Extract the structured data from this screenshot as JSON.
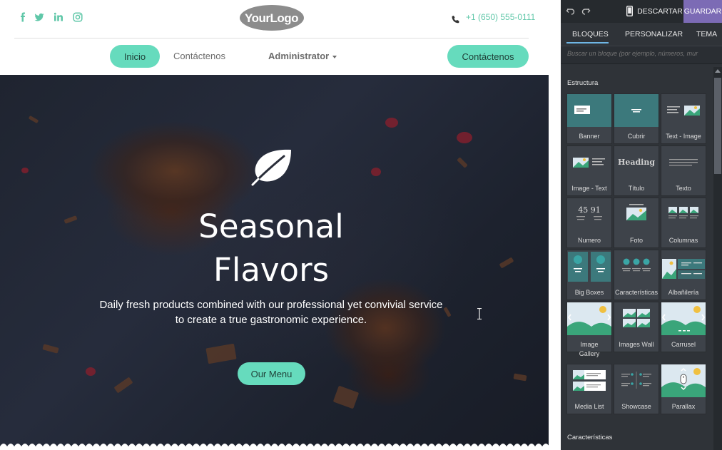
{
  "site": {
    "logo_text": "YourLogo",
    "phone": "+1 (650) 555-0111",
    "social": [
      "facebook-icon",
      "twitter-icon",
      "linkedin-icon",
      "instagram-icon"
    ],
    "nav": {
      "home": "Inicio",
      "contact": "Contáctenos",
      "admin": "Administrator",
      "cta": "Contáctenos"
    },
    "hero": {
      "title": "Seasonal\nFlavors",
      "subtitle": "Daily fresh products combined with our professional yet convivial service\nto create a true gastronomic experience.",
      "button": "Our Menu"
    },
    "accent": "#66dbbd",
    "icon_accent": "#5fc7a8"
  },
  "editor": {
    "discard": "DESCARTAR",
    "save": "GUARDAR",
    "save_color": "#7c6bb5",
    "tabs": [
      "BLOQUES",
      "PERSONALIZAR",
      "TEMA"
    ],
    "active_tab": "BLOQUES",
    "search_placeholder": "Buscar un bloque (por ejemplo, números, mur",
    "sections": {
      "structure": "Estructura",
      "features": "Características"
    },
    "blocks": [
      {
        "label": "Banner",
        "icon": "banner-icon"
      },
      {
        "label": "Cubrir",
        "icon": "cover-icon"
      },
      {
        "label": "Text - Image",
        "icon": "text-image-icon"
      },
      {
        "label": "Image - Text",
        "icon": "image-text-icon"
      },
      {
        "label": "Título",
        "icon": "heading-icon",
        "thumb_text": "Heading"
      },
      {
        "label": "Texto",
        "icon": "text-icon"
      },
      {
        "label": "Numero",
        "icon": "numbers-icon",
        "thumb_text": "45 91"
      },
      {
        "label": "Foto",
        "icon": "picture-icon"
      },
      {
        "label": "Columnas",
        "icon": "columns-icon"
      },
      {
        "label": "Big Boxes",
        "icon": "big-boxes-icon"
      },
      {
        "label": "Características",
        "icon": "features-icon"
      },
      {
        "label": "Albañilería",
        "icon": "masonry-icon"
      },
      {
        "label": "Image\nGallery",
        "icon": "image-gallery-icon"
      },
      {
        "label": "Images Wall",
        "icon": "images-wall-icon"
      },
      {
        "label": "Carrusel",
        "icon": "carousel-icon"
      },
      {
        "label": "Media List",
        "icon": "media-list-icon"
      },
      {
        "label": "Showcase",
        "icon": "showcase-icon"
      },
      {
        "label": "Parallax",
        "icon": "parallax-icon"
      }
    ]
  }
}
